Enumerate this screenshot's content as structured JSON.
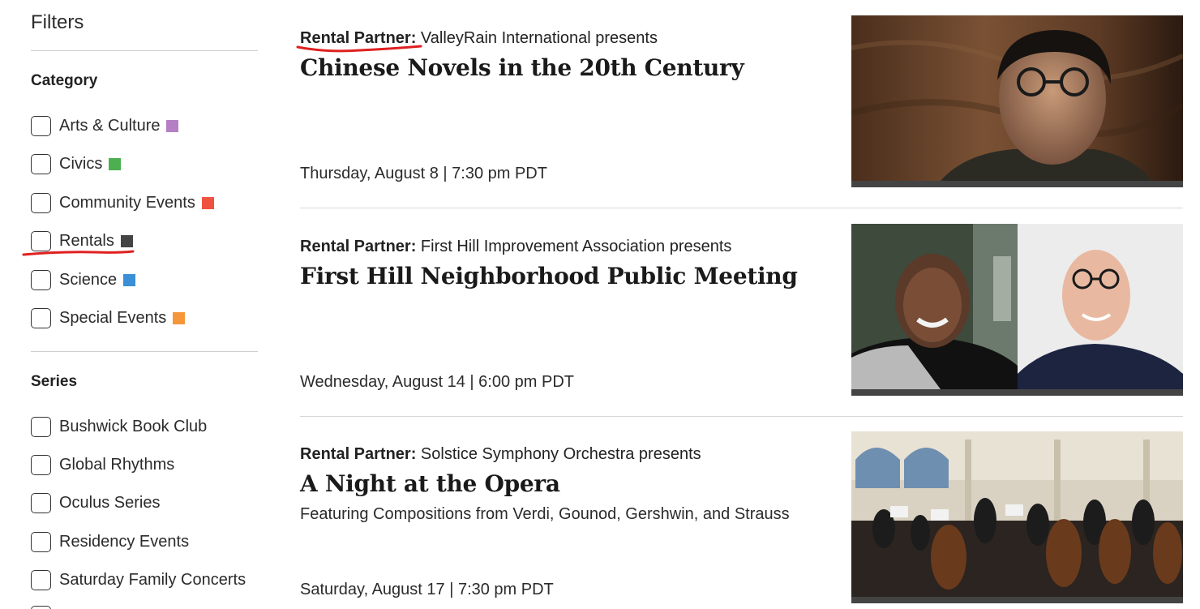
{
  "filters": {
    "title": "Filters",
    "category_heading": "Category",
    "categories": [
      {
        "label": "Arts & Culture",
        "color": "#b57fc4"
      },
      {
        "label": "Civics",
        "color": "#4caf50"
      },
      {
        "label": "Community Events",
        "color": "#ef5340"
      },
      {
        "label": "Rentals",
        "color": "#444444"
      },
      {
        "label": "Science",
        "color": "#3a8fd6"
      },
      {
        "label": "Special Events",
        "color": "#f5963a"
      }
    ],
    "series_heading": "Series",
    "series": [
      {
        "label": "Bushwick Book Club"
      },
      {
        "label": "Global Rhythms"
      },
      {
        "label": "Oculus Series"
      },
      {
        "label": "Residency Events"
      },
      {
        "label": "Saturday Family Concerts"
      }
    ]
  },
  "events": [
    {
      "partner_prefix": "Rental Partner:",
      "partner_text": " ValleyRain International presents",
      "title": "Chinese Novels in the 20th Century",
      "subtitle": "",
      "date": "Thursday, August 8 | 7:30 pm PDT",
      "image_icon": "portrait-photo-icon"
    },
    {
      "partner_prefix": "Rental Partner:",
      "partner_text": " First Hill Improvement Association presents",
      "title": "First Hill Neighborhood Public Meeting",
      "subtitle": "",
      "date": "Wednesday, August 14 | 6:00 pm PDT",
      "image_icon": "two-people-photo-icon"
    },
    {
      "partner_prefix": "Rental Partner:",
      "partner_text": " Solstice Symphony Orchestra presents",
      "title": "A Night at the Opera",
      "subtitle": "Featuring Compositions from Verdi, Gounod, Gershwin, and Strauss",
      "date": "Saturday, August 17 | 7:30 pm PDT",
      "image_icon": "orchestra-photo-icon"
    }
  ],
  "annotation_color": "#e02020"
}
